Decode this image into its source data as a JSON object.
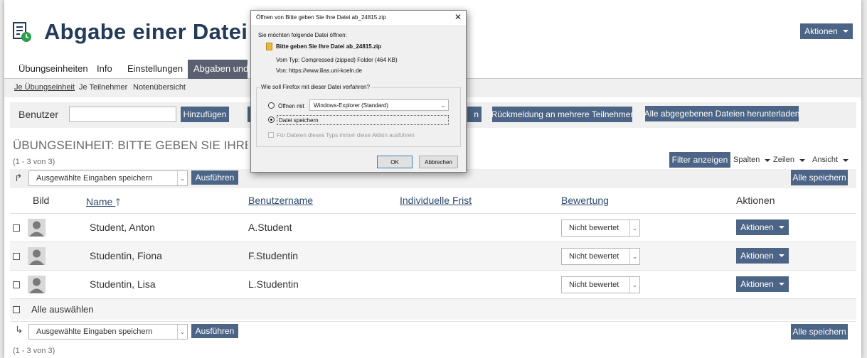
{
  "page": {
    "title": "Abgabe einer Datei",
    "actions_label": "Aktionen"
  },
  "tabs": {
    "items": [
      "Übungseinheiten",
      "Info",
      "Einstellungen"
    ],
    "active": "Abgaben und Noten"
  },
  "subtabs": [
    "Je Übungseinheit",
    "Je Teilnehmer",
    "Notenübersicht"
  ],
  "toolbar": {
    "user_label": "Benutzer",
    "add_label": "Hinzufügen",
    "hidden_btn_partial": "n",
    "feedback_label": "Rückmeldung an mehrere Teilnehmer",
    "download_label": "Alle abgegebenen Dateien herunterladen"
  },
  "section": {
    "title": "ÜBUNGSEINHEIT: BITTE GEBEN SIE IHRE DATEI AB",
    "count": "(1 - 3 von 3)",
    "filter_label": "Filter anzeigen",
    "columns_label": "Spalten",
    "rows_label": "Zeilen",
    "view_label": "Ansicht"
  },
  "bulk": {
    "select_value": "Ausgewählte Eingaben speichern",
    "execute_label": "Ausführen",
    "save_all_label": "Alle speichern"
  },
  "table": {
    "headers": {
      "image": "Bild",
      "name": "Name",
      "username": "Benutzername",
      "deadline": "Individuelle Frist",
      "grade": "Bewertung",
      "actions": "Aktionen"
    },
    "rows": [
      {
        "name": "Student, Anton",
        "username": "A.Student",
        "grade": "Nicht bewertet",
        "action": "Aktionen"
      },
      {
        "name": "Studentin, Fiona",
        "username": "F.Studentin",
        "grade": "Nicht bewertet",
        "action": "Aktionen"
      },
      {
        "name": "Studentin, Lisa",
        "username": "L.Studentin",
        "grade": "Nicht bewertet",
        "action": "Aktionen"
      }
    ],
    "select_all": "Alle auswählen"
  },
  "dialog": {
    "title": "Öffnen von Bitte geben Sie Ihre Datei ab_24815.zip",
    "intro": "Sie möchten folgende Datei öffnen:",
    "filename": "Bitte geben Sie Ihre Datei ab_24815.zip",
    "type_label": "Vom Typ:",
    "type_value": "Compressed (zipped) Folder (464 KB)",
    "from_label": "Von:",
    "from_value": "https://www.ilias.uni-koeln.de",
    "question": "Wie soll Firefox mit dieser Datei verfahren?",
    "open_with_label": "Öffnen mit",
    "open_with_value": "Windows-Explorer (Standard)",
    "save_label": "Datei speichern",
    "always_label": "Für Dateien dieses Typs immer diese Aktion ausführen",
    "ok_label": "OK",
    "cancel_label": "Abbrechen"
  },
  "colors": {
    "accent": "#4c6586",
    "title": "#233a58"
  }
}
